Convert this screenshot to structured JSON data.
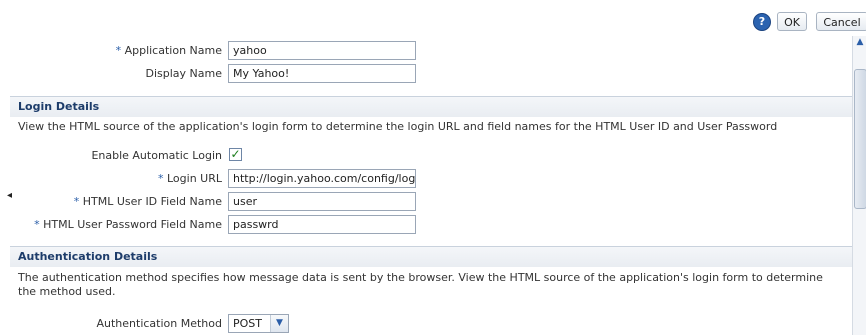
{
  "toolbar": {
    "help_icon": "?",
    "ok_label": "OK",
    "cancel_label": "Cancel"
  },
  "app": {
    "application_name_label": "Application Name",
    "application_name_value": "yahoo",
    "display_name_label": "Display Name",
    "display_name_value": "My Yahoo!"
  },
  "login_details": {
    "title": "Login Details",
    "description": "View the HTML source of the application's login form to determine the login URL and field names for the HTML User ID and User Password",
    "enable_auto_login_label": "Enable Automatic Login",
    "enable_auto_login_checked": true,
    "login_url_label": "Login URL",
    "login_url_value": "http://login.yahoo.com/config/login",
    "user_id_field_label": "HTML User ID Field Name",
    "user_id_field_value": "user",
    "password_field_label": "HTML User Password Field Name",
    "password_field_value": "passwrd"
  },
  "authentication_details": {
    "title": "Authentication Details",
    "description": "The authentication method specifies how message data is sent by the browser. View the HTML source of the application's login form to determine the method used.",
    "method_label": "Authentication Method",
    "method_value": "POST"
  },
  "colors": {
    "required_marker": "#2a5ea8",
    "section_title": "#1d3c6a",
    "checkbox_check": "#1c7d1c"
  },
  "markers": {
    "required": "*"
  }
}
